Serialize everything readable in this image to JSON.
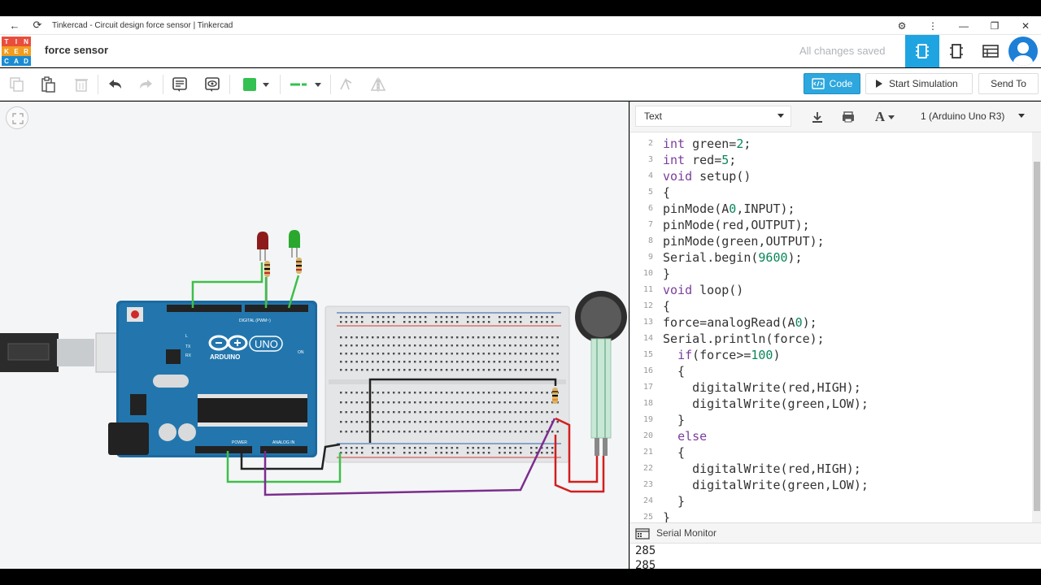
{
  "browser": {
    "tab_title": "Tinkercad - Circuit design force sensor | Tinkercad"
  },
  "app": {
    "logo_letters": [
      "T",
      "I",
      "N",
      "K",
      "E",
      "R",
      "C",
      "A",
      "D"
    ],
    "logo_colors": [
      "#e94e3d",
      "#e94e3d",
      "#e94e3d",
      "#f29c1f",
      "#f29c1f",
      "#f29c1f",
      "#1b8bd1",
      "#1b8bd1",
      "#1b8bd1"
    ],
    "project_name": "force sensor",
    "save_status": "All changes saved",
    "accent_color": "#1ea4e1"
  },
  "toolbar": {
    "code_label": "Code",
    "start_sim_label": "Start Simulation",
    "send_to_label": "Send To",
    "fill_color": "#33c151"
  },
  "code_panel": {
    "mode": "Text",
    "device": "1 (Arduino Uno R3)",
    "lines": [
      {
        "n": "2",
        "text": "int green=2;"
      },
      {
        "n": "3",
        "text": "int red=5;"
      },
      {
        "n": "4",
        "text": "void setup()"
      },
      {
        "n": "5",
        "text": "{"
      },
      {
        "n": "6",
        "text": "pinMode(A0,INPUT);"
      },
      {
        "n": "7",
        "text": "pinMode(red,OUTPUT);"
      },
      {
        "n": "8",
        "text": "pinMode(green,OUTPUT);"
      },
      {
        "n": "9",
        "text": "Serial.begin(9600);"
      },
      {
        "n": "10",
        "text": "}"
      },
      {
        "n": "11",
        "text": "void loop()"
      },
      {
        "n": "12",
        "text": "{"
      },
      {
        "n": "13",
        "text": "force=analogRead(A0);"
      },
      {
        "n": "14",
        "text": "Serial.println(force);"
      },
      {
        "n": "15",
        "text": "  if(force>=100)"
      },
      {
        "n": "16",
        "text": "  {"
      },
      {
        "n": "17",
        "text": "    digitalWrite(red,HIGH);"
      },
      {
        "n": "18",
        "text": "    digitalWrite(green,LOW);"
      },
      {
        "n": "19",
        "text": "  }"
      },
      {
        "n": "20",
        "text": "  else"
      },
      {
        "n": "21",
        "text": "  {"
      },
      {
        "n": "22",
        "text": "    digitalWrite(red,HIGH);"
      },
      {
        "n": "23",
        "text": "    digitalWrite(green,LOW);"
      },
      {
        "n": "24",
        "text": "  }"
      },
      {
        "n": "25",
        "text": "}"
      }
    ]
  },
  "serial_monitor": {
    "label": "Serial Monitor",
    "output": [
      "285",
      "285"
    ]
  },
  "board": {
    "brand": "ARDUINO",
    "model": "UNO",
    "digital_label": "DIGITAL (PWM~)",
    "power_label": "POWER",
    "analog_label": "ANALOG IN",
    "on_label": "ON",
    "tx_label": "TX",
    "rx_label": "RX",
    "l_label": "L"
  }
}
